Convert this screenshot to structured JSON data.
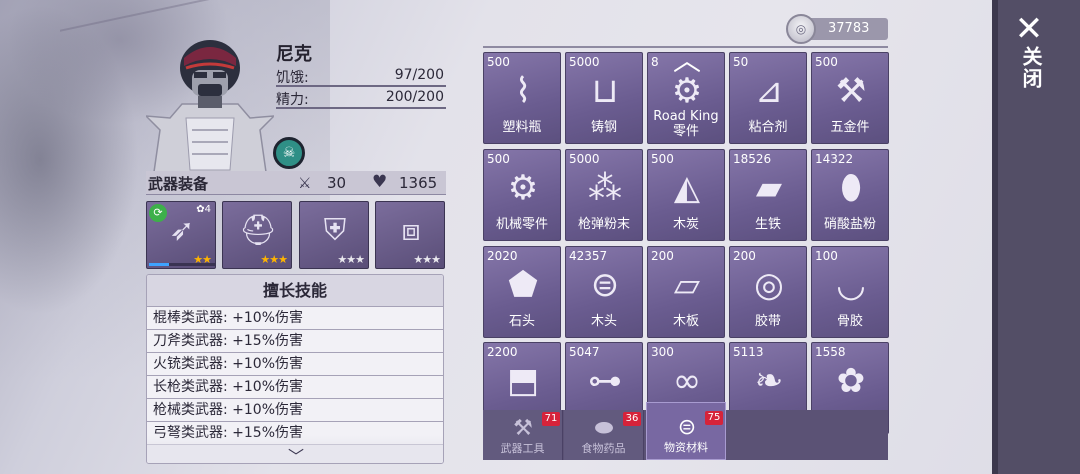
{
  "close": {
    "label": "关闭"
  },
  "character": {
    "name": "尼克",
    "hunger_label": "饥饿:",
    "hunger_value": "97/200",
    "energy_label": "精力:",
    "energy_value": "200/200"
  },
  "equipment": {
    "title": "武器装备",
    "attack": "30",
    "health": "1365",
    "slots": [
      {
        "icon": "bow-icon",
        "stars": "★★",
        "star_color": "gold",
        "level": "✿4",
        "progress": 0.3
      },
      {
        "icon": "helmet-icon",
        "stars": "★★★",
        "star_color": "gold"
      },
      {
        "icon": "chest-armor-icon",
        "stars": "★★★",
        "star_color": "silver"
      },
      {
        "icon": "leg-armor-icon",
        "stars": "★★★",
        "star_color": "silver"
      }
    ]
  },
  "skills": {
    "title": "擅长技能",
    "rows": [
      "棍棒类武器: +10%伤害",
      "刀斧类武器: +15%伤害",
      "火铳类武器: +10%伤害",
      "长枪类武器: +10%伤害",
      "枪械类武器: +10%伤害",
      "弓弩类武器: +15%伤害"
    ]
  },
  "currency": {
    "value": "37783"
  },
  "items": [
    {
      "qty": "500",
      "name": "塑料瓶",
      "icon": "plastic-bottle-icon"
    },
    {
      "qty": "5000",
      "name": "铸钢",
      "icon": "cast-steel-icon"
    },
    {
      "qty": "8",
      "name": "Road King零件",
      "icon": "road-king-parts-icon"
    },
    {
      "qty": "50",
      "name": "粘合剂",
      "icon": "glue-icon"
    },
    {
      "qty": "500",
      "name": "五金件",
      "icon": "hardware-icon"
    },
    {
      "qty": "500",
      "name": "机械零件",
      "icon": "gear-parts-icon"
    },
    {
      "qty": "5000",
      "name": "枪弹粉末",
      "icon": "gunpowder-icon"
    },
    {
      "qty": "500",
      "name": "木炭",
      "icon": "charcoal-icon"
    },
    {
      "qty": "18526",
      "name": "生铁",
      "icon": "pig-iron-icon"
    },
    {
      "qty": "14322",
      "name": "硝酸盐粉",
      "icon": "nitrate-powder-icon"
    },
    {
      "qty": "2020",
      "name": "石头",
      "icon": "stone-icon"
    },
    {
      "qty": "42357",
      "name": "木头",
      "icon": "wood-log-icon"
    },
    {
      "qty": "200",
      "name": "木板",
      "icon": "wood-plank-icon"
    },
    {
      "qty": "200",
      "name": "胶带",
      "icon": "tape-icon"
    },
    {
      "qty": "100",
      "name": "骨胶",
      "icon": "bone-glue-icon"
    },
    {
      "qty": "2200",
      "name": "",
      "icon": "cloth-icon"
    },
    {
      "qty": "5047",
      "name": "",
      "icon": "pipe-icon"
    },
    {
      "qty": "300",
      "name": "",
      "icon": "rope-icon"
    },
    {
      "qty": "5113",
      "name": "",
      "icon": "herb-icon"
    },
    {
      "qty": "1558",
      "name": "",
      "icon": "flower-icon"
    }
  ],
  "tabs": [
    {
      "label": "武器工具",
      "count": "71",
      "icon": "weapon-tools-icon",
      "active": false
    },
    {
      "label": "食物药品",
      "count": "36",
      "icon": "food-medicine-icon",
      "active": false
    },
    {
      "label": "物资材料",
      "count": "75",
      "icon": "materials-icon",
      "active": true
    }
  ]
}
